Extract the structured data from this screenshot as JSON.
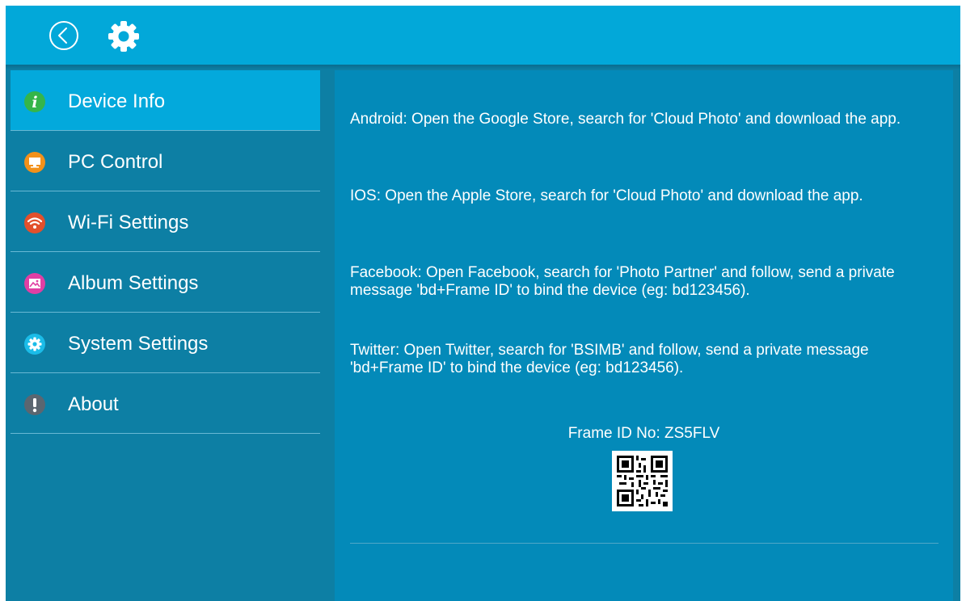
{
  "header": {
    "back_icon": "back-circle-icon",
    "settings_icon": "gear-icon"
  },
  "sidebar": {
    "items": [
      {
        "label": "Device Info",
        "icon": "info-icon",
        "icon_color": "#35b54a",
        "active": true
      },
      {
        "label": "PC Control",
        "icon": "monitor-icon",
        "icon_color": "#f2911b",
        "active": false
      },
      {
        "label": "Wi-Fi Settings",
        "icon": "wifi-icon",
        "icon_color": "#e2502c",
        "active": false
      },
      {
        "label": "Album Settings",
        "icon": "image-icon",
        "icon_color": "#e03fa4",
        "active": false
      },
      {
        "label": "System Settings",
        "icon": "gear-icon",
        "icon_color": "#1bbce8",
        "active": false
      },
      {
        "label": "About",
        "icon": "exclamation-icon",
        "icon_color": "#5b6670",
        "active": false
      }
    ]
  },
  "content": {
    "android_text": "Android: Open the Google Store, search for 'Cloud Photo' and download the app.",
    "ios_text": "IOS: Open the Apple Store, search for 'Cloud Photo' and download the app.",
    "facebook_text": "Facebook: Open Facebook, search for 'Photo Partner' and follow, send a private message 'bd+Frame ID' to bind the device (eg: bd123456).",
    "twitter_text": "Twitter: Open Twitter, search for 'BSIMB' and follow, send a private message 'bd+Frame ID' to bind the device (eg: bd123456).",
    "frame_id": "Frame ID No: ZS5FLV",
    "qr_icon": "qr-code-icon"
  },
  "colors": {
    "topbar": "#02a8d9",
    "background": "#0d7fa4",
    "active_item": "#03a9dc",
    "content_panel": "#038ab9"
  }
}
